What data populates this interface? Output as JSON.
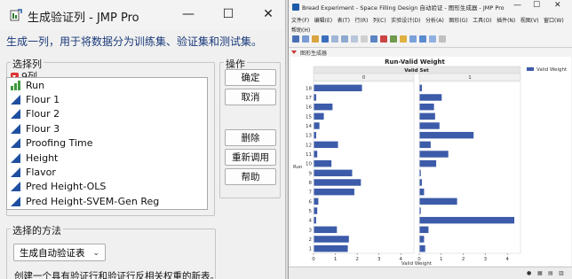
{
  "dialog": {
    "title": "生成验证列 - JMP Pro",
    "window_controls": {
      "minimize": "—",
      "maximize": "☐",
      "close": "✕"
    },
    "description": "生成一列，用于将数据分为训练集、验证集和测试集。",
    "select_columns": {
      "title": "选择列",
      "count_label": "9列",
      "columns": [
        {
          "name": "Run",
          "icon": "ordinal-bar-icon"
        },
        {
          "name": "Flour 1",
          "icon": "continuous-triangle-icon"
        },
        {
          "name": "Flour 2",
          "icon": "continuous-triangle-icon"
        },
        {
          "name": "Flour 3",
          "icon": "continuous-triangle-icon"
        },
        {
          "name": "Proofing Time",
          "icon": "continuous-triangle-icon"
        },
        {
          "name": "Height",
          "icon": "continuous-triangle-icon"
        },
        {
          "name": "Flavor",
          "icon": "continuous-triangle-icon"
        },
        {
          "name": "Pred Height-OLS",
          "icon": "continuous-triangle-icon"
        },
        {
          "name": "Pred Height-SVEM-Gen Reg",
          "icon": "continuous-triangle-icon"
        }
      ]
    },
    "actions": {
      "title": "操作",
      "ok": "确定",
      "cancel": "取消",
      "remove": "删除",
      "recall": "重新调用",
      "help": "帮助"
    },
    "method": {
      "title": "选择的方法",
      "selected": "生成自动验证表",
      "note": "创建一个具有验证行和验证行反相关权重的新表。"
    }
  },
  "jmp_window": {
    "title": "Bread Experiment - Space Filling Design 自动验证 - 图形生成器 - JMP Pro",
    "window_controls": {
      "minimize": "—",
      "maximize": "☐",
      "close": "✕"
    },
    "menus": [
      "文件(F)",
      "编辑(E)",
      "表(T)",
      "行(R)",
      "列(C)",
      "实验设计(D)",
      "分析(A)",
      "图形(G)",
      "工具(O)",
      "插件(N)",
      "视图(V)",
      "窗口(W)"
    ],
    "help_menu": "帮助(H)",
    "panel_header": "图形生成器",
    "colors": {
      "bar": "#3c5ba9",
      "accent": "#1e5aa8"
    }
  },
  "chart_data": {
    "type": "bar",
    "orientation": "horizontal",
    "title": "Run-Valid Weight",
    "facet_title": "Valid Set",
    "facets": [
      "0",
      "1"
    ],
    "ylabel": "Run",
    "xlabel": "Valid Weight",
    "legend": [
      "Valid Weight"
    ],
    "legend_placement": "right",
    "categories": [
      "1",
      "2",
      "3",
      "4",
      "5",
      "6",
      "7",
      "8",
      "9",
      "10",
      "11",
      "12",
      "13",
      "14",
      "15",
      "16",
      "17",
      "18"
    ],
    "xticks": [
      "0",
      "1",
      "2",
      "3",
      "4"
    ],
    "xlim": [
      0,
      4.6
    ],
    "series": [
      {
        "name": "0",
        "values": [
          1.55,
          1.6,
          1.05,
          0.1,
          0.15,
          0.2,
          1.85,
          2.15,
          1.75,
          0.8,
          0.15,
          1.1,
          0.1,
          0.25,
          0.45,
          0.85,
          0.1,
          2.2
        ]
      },
      {
        "name": "1",
        "values": [
          0.25,
          0.2,
          0.4,
          4.3,
          0.05,
          1.7,
          0.2,
          0.1,
          0.05,
          0.75,
          1.3,
          0.5,
          2.45,
          0.9,
          0.7,
          0.65,
          1.0,
          0.1
        ]
      }
    ],
    "grid": false
  }
}
